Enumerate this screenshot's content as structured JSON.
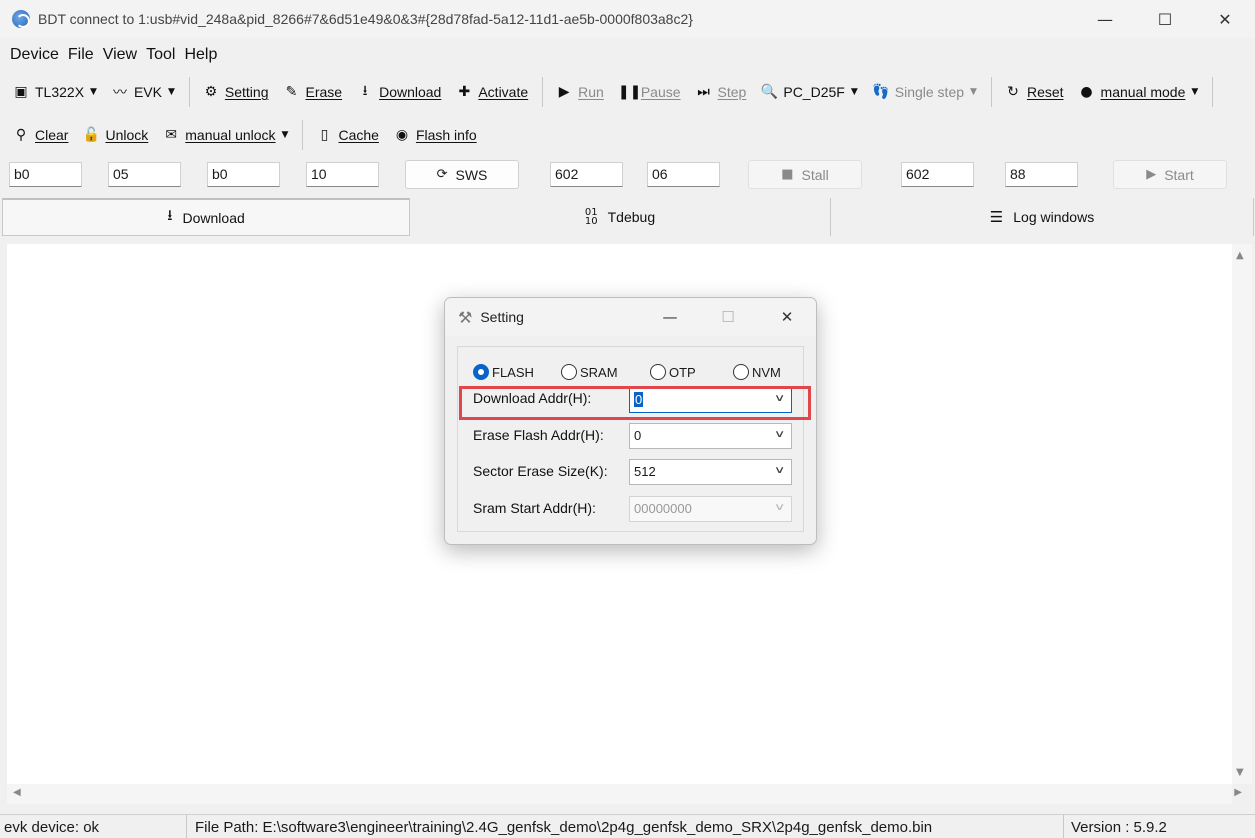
{
  "window": {
    "title": "BDT connect to 1:usb#vid_248a&pid_8266#7&6d51e49&0&3#{28d78fad-5a12-11d1-ae5b-0000f803a8c2}",
    "minimize": "—",
    "maximize": "☐",
    "close": "✕"
  },
  "menu": [
    "Device",
    "File",
    "View",
    "Tool",
    "Help"
  ],
  "toolbar1": {
    "chip": "TL322X",
    "board": "EVK",
    "setting": "Setting",
    "erase": "Erase",
    "download": "Download",
    "activate": "Activate",
    "run": "Run",
    "pause": "Pause",
    "step": "Step",
    "pc": "PC_D25F",
    "single_step": "Single step",
    "reset": "Reset",
    "mode": "manual mode"
  },
  "toolbar2": {
    "clear": "Clear",
    "unlock": "Unlock",
    "manual_unlock": "manual unlock",
    "cache": "Cache",
    "flash_info": "Flash info"
  },
  "sws_row": {
    "fields": [
      "b0",
      "05",
      "b0",
      "10"
    ],
    "sws_label": "SWS",
    "stall_fields": [
      "602",
      "06"
    ],
    "stall_label": "Stall",
    "start_fields": [
      "602",
      "88"
    ],
    "start_label": "Start"
  },
  "tabs": [
    {
      "label": "Download",
      "icon": "download-arrow-icon"
    },
    {
      "label": "Tdebug",
      "icon": "binary-icon"
    },
    {
      "label": "Log windows",
      "icon": "list-icon"
    }
  ],
  "status": {
    "device": "evk device: ok",
    "file_path": "File Path:  E:\\software3\\engineer\\training\\2.4G_genfsk_demo\\2p4g_genfsk_demo_SRX\\2p4g_genfsk_demo.bin",
    "version": "Version : 5.9.2"
  },
  "dialog": {
    "title": "Setting",
    "radios": [
      {
        "label": "FLASH",
        "checked": true
      },
      {
        "label": "SRAM",
        "checked": false
      },
      {
        "label": "OTP",
        "checked": false
      },
      {
        "label": "NVM",
        "checked": false
      }
    ],
    "download_addr_label": "Download  Addr(H):",
    "download_addr_value": "0",
    "erase_addr_label": "Erase Flash Addr(H):",
    "erase_addr_value": "0",
    "sector_size_label": "Sector Erase Size(K):",
    "sector_size_value": "512",
    "sram_addr_label": "Sram Start Addr(H):",
    "sram_addr_value": "00000000"
  },
  "colors": {
    "accent": "#0a64c8",
    "highlight": "#e0474c"
  }
}
